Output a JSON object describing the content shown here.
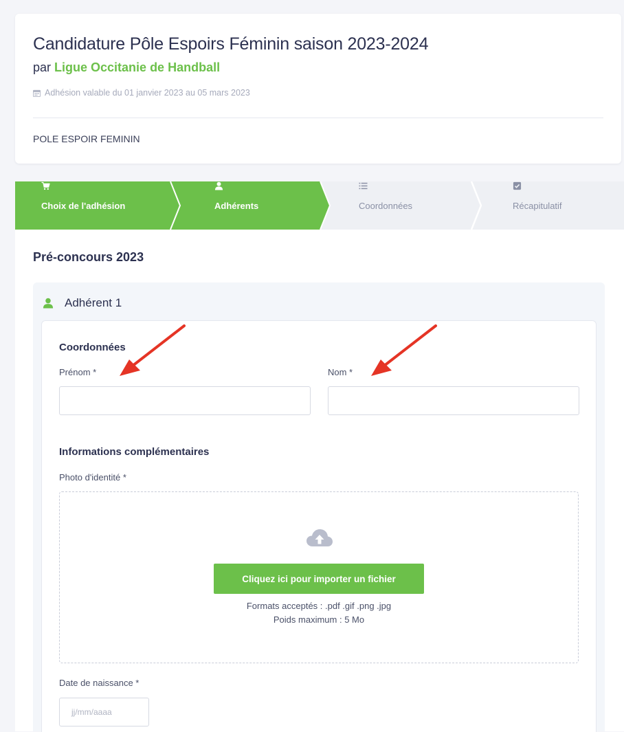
{
  "header": {
    "title": "Candidature Pôle Espoirs Féminin saison 2023-2024",
    "by_prefix": "par",
    "organization": "Ligue Occitanie de Handball",
    "validity": "Adhésion valable du 01 janvier 2023 au 05 mars 2023",
    "subtitle": "POLE ESPOIR FEMININ"
  },
  "stepper": {
    "steps": [
      {
        "label": "Choix de l'adhésion",
        "icon": "cart-icon",
        "state": "done"
      },
      {
        "label": "Adhérents",
        "icon": "user-icon",
        "state": "active"
      },
      {
        "label": "Coordonnées",
        "icon": "list-icon",
        "state": "inactive"
      },
      {
        "label": "Récapitulatif",
        "icon": "check-square-icon",
        "state": "inactive"
      }
    ]
  },
  "form": {
    "section_title": "Pré-concours 2023",
    "member_title": "Adhérent 1",
    "coordinates_title": "Coordonnées",
    "first_name_label": "Prénom *",
    "first_name_value": "",
    "last_name_label": "Nom *",
    "last_name_value": "",
    "extra_info_title": "Informations complémentaires",
    "photo_label": "Photo d'identité *",
    "upload_button": "Cliquez ici pour importer un fichier",
    "formats": "Formats acceptés : .pdf .gif .png .jpg",
    "max_size": "Poids maximum : 5 Mo",
    "birthdate_label": "Date de naissance *",
    "birthdate_placeholder": "jj/mm/aaaa"
  },
  "colors": {
    "accent_green": "#6cc04a",
    "step_inactive_bg": "#eef0f4",
    "annotation_red": "#e53425"
  }
}
